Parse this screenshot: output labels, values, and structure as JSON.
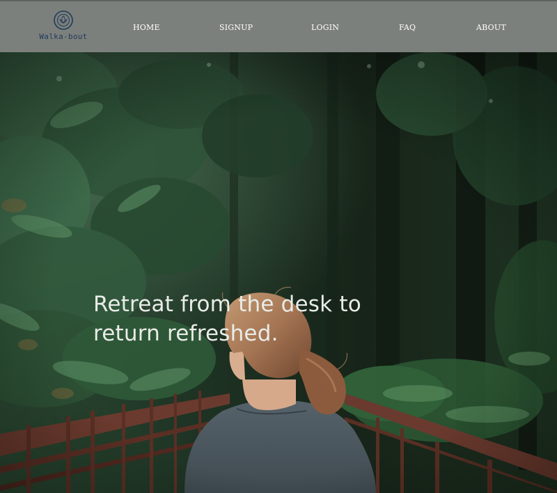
{
  "header": {
    "logo": {
      "icon": "lotus-icon",
      "text": "Walka-bout"
    },
    "nav": [
      {
        "label": "HOME"
      },
      {
        "label": "SIGNUP"
      },
      {
        "label": "LOGIN"
      },
      {
        "label": "FAQ"
      },
      {
        "label": "ABOUT"
      }
    ]
  },
  "hero": {
    "headline_line1": "Retreat from the desk to",
    "headline_line2": "return refreshed.",
    "image": "forest-bridge-photo"
  },
  "colors": {
    "header_bg": "#7c807c",
    "logo_blue": "#1f3a5a",
    "nav_text": "#ffffff",
    "headline_text": "#e9ece8",
    "forest_dark": "#1c2a1f",
    "bridge_rust": "#6b3a2e"
  }
}
